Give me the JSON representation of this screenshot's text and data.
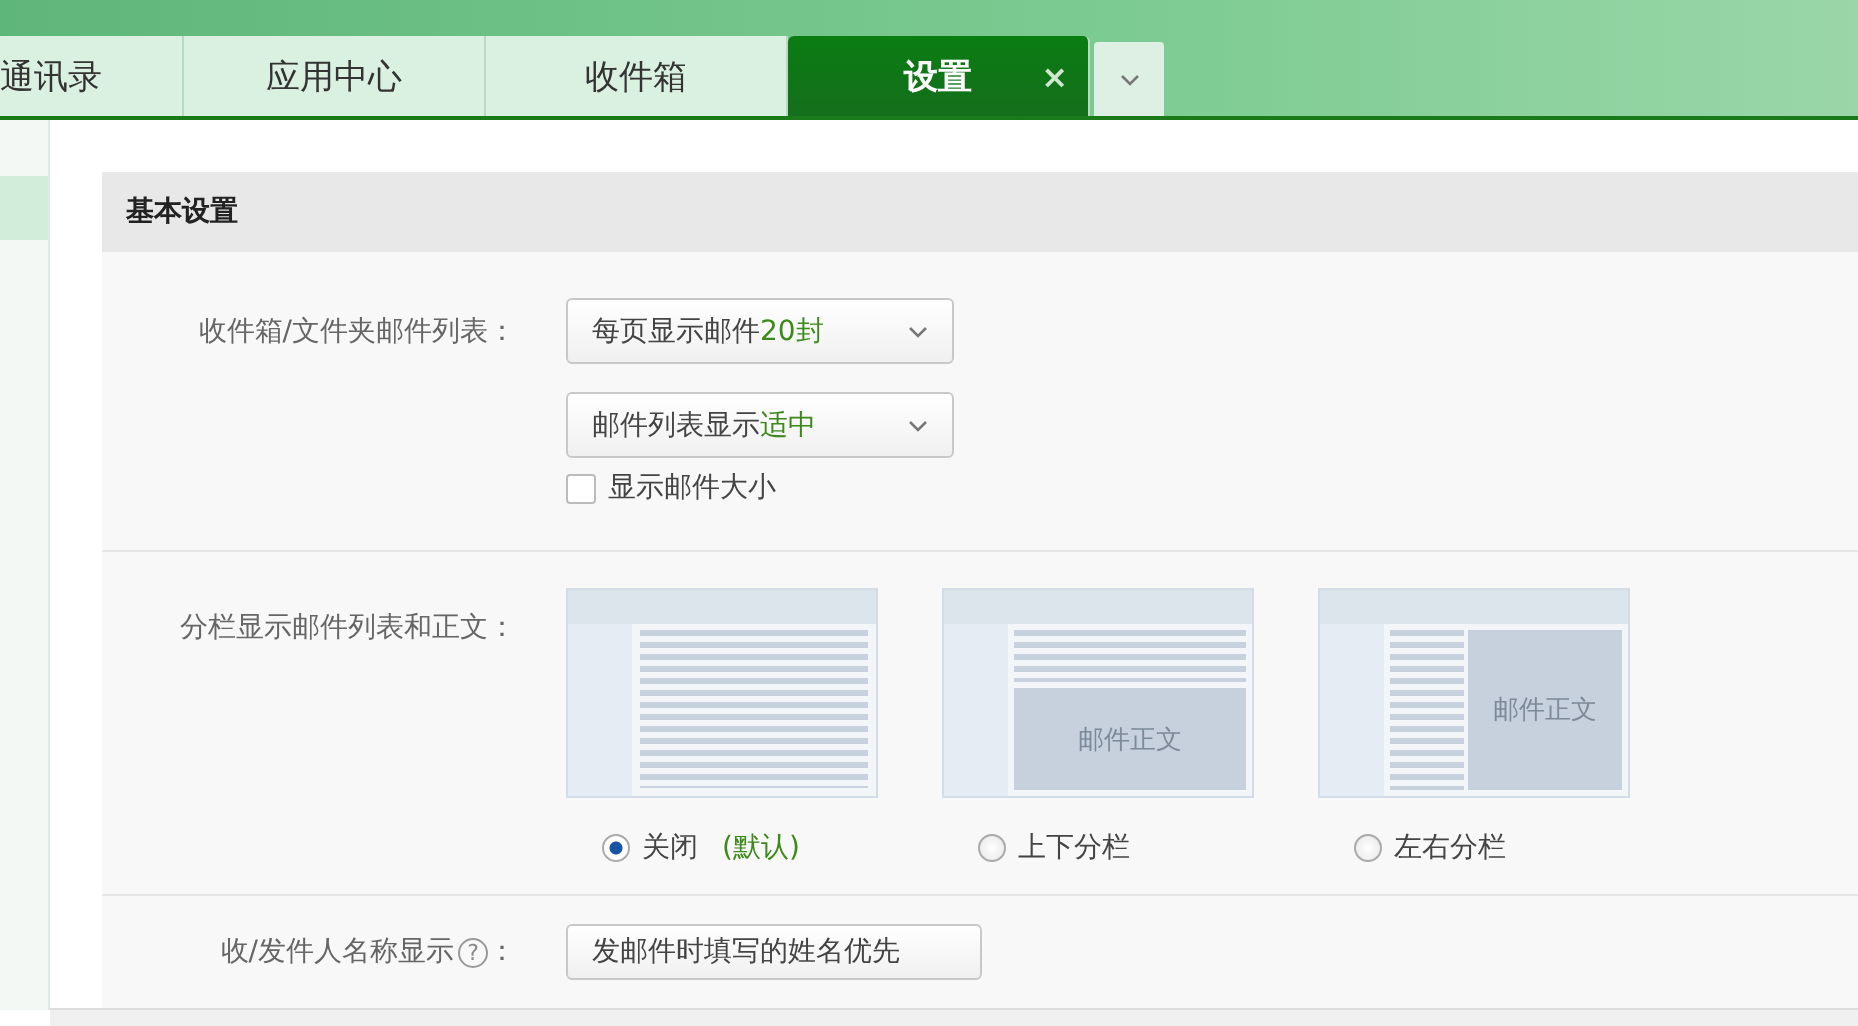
{
  "tabs": [
    {
      "label": "通讯录",
      "selected": false,
      "closable": false
    },
    {
      "label": "应用中心",
      "selected": false,
      "closable": false
    },
    {
      "label": "收件箱",
      "selected": false,
      "closable": false
    },
    {
      "label": "设置",
      "selected": true,
      "closable": true,
      "close_icon": "×"
    }
  ],
  "section": {
    "title": "基本设置",
    "list_row": {
      "label": "收件箱/文件夹邮件列表：",
      "selects": [
        {
          "text": "每页显示邮件",
          "highlight": "20封"
        },
        {
          "text": "邮件列表显示",
          "highlight": "适中"
        }
      ],
      "checkbox": {
        "label": "显示邮件大小",
        "checked": false
      }
    },
    "split_row": {
      "label": "分栏显示邮件列表和正文：",
      "options": [
        {
          "kind": "none",
          "label": "关闭",
          "note": "(默认)",
          "selected": true
        },
        {
          "kind": "top-bottom",
          "label": "上下分栏",
          "body_label": "邮件正文",
          "selected": false
        },
        {
          "kind": "left-right",
          "label": "左右分栏",
          "body_label": "邮件正文",
          "selected": false
        }
      ]
    },
    "name_row": {
      "label": "收/发件人名称显示",
      "help": "?",
      "colon": "：",
      "select": "发邮件时填写的姓名优先"
    }
  }
}
